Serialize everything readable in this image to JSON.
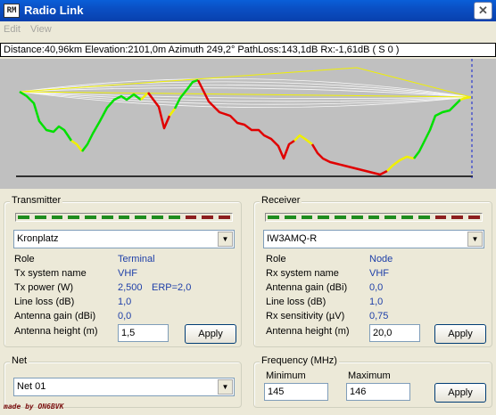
{
  "window": {
    "title": "Radio Link",
    "icon_text": "RM",
    "close_glyph": "✕"
  },
  "menu": {
    "items": [
      "Edit",
      "View"
    ]
  },
  "info": {
    "text": "Distance:40,96km  Elevation:2101,0m  Azimuth 249,2°  PathLoss:143,1dB  Rx:-1,61dB  ( S 0 )"
  },
  "colors": {
    "profile_bg": "#c0c0c0",
    "terrain_green": "#00e000",
    "terrain_red": "#e00000",
    "terrain_yellow": "#f0f000",
    "signal_green": "#1e8c1e",
    "signal_red": "#8c1e1e",
    "value_blue": "#1e3fa8"
  },
  "transmitter": {
    "title": "Transmitter",
    "signal": [
      "g",
      "g",
      "g",
      "g",
      "g",
      "g",
      "g",
      "g",
      "g",
      "g",
      "r",
      "r",
      "r"
    ],
    "site": "Kronplatz",
    "rows": [
      {
        "label": "Role",
        "value": "Terminal"
      },
      {
        "label": "Tx system name",
        "value": "VHF"
      },
      {
        "label": "Tx power (W)",
        "value": "2,500",
        "extra": "ERP=2,0"
      },
      {
        "label": "Line loss (dB)",
        "value": "1,0"
      },
      {
        "label": "Antenna gain (dBi)",
        "value": "0,0"
      }
    ],
    "antenna_label": "Antenna height (m)",
    "antenna_height": "1,5",
    "apply": "Apply"
  },
  "receiver": {
    "title": "Receiver",
    "signal": [
      "g",
      "g",
      "g",
      "g",
      "g",
      "g",
      "g",
      "g",
      "g",
      "g",
      "r",
      "r",
      "r"
    ],
    "site": "IW3AMQ-R",
    "rows": [
      {
        "label": "Role",
        "value": "Node"
      },
      {
        "label": "Rx system name",
        "value": "VHF"
      },
      {
        "label": "Antenna gain (dBi)",
        "value": "0,0"
      },
      {
        "label": "Line loss (dB)",
        "value": "1,0"
      },
      {
        "label": "Rx sensitivity (µV)",
        "value": "0,75"
      }
    ],
    "antenna_label": "Antenna height (m)",
    "antenna_height": "20,0",
    "apply": "Apply"
  },
  "net": {
    "title": "Net",
    "value": "Net 01"
  },
  "frequency": {
    "title": "Frequency (MHz)",
    "min_label": "Minimum",
    "min": "145",
    "max_label": "Maximum",
    "max": "146",
    "apply": "Apply"
  },
  "credit": "made by ON6BVK"
}
